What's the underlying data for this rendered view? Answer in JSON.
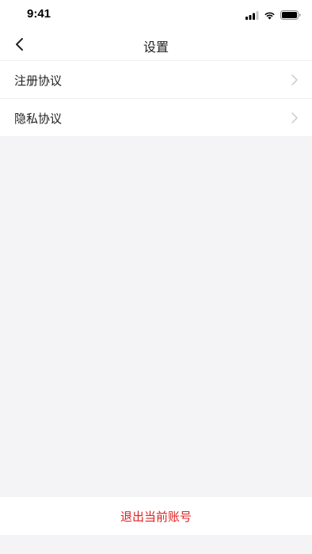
{
  "status_bar": {
    "time": "9:41",
    "icons": [
      "signal-icon",
      "wifi-icon",
      "battery-icon"
    ]
  },
  "nav": {
    "back_icon": "back-icon",
    "title": "设置"
  },
  "settings": {
    "items": [
      {
        "label": "注册协议",
        "icon": "chevron-right-icon"
      },
      {
        "label": "隐私协议",
        "icon": "chevron-right-icon"
      }
    ]
  },
  "logout": {
    "label": "退出当前账号"
  },
  "colors": {
    "background": "#f4f4f6",
    "surface": "#ffffff",
    "danger": "#e02020",
    "chevron": "#c7c7cc"
  }
}
